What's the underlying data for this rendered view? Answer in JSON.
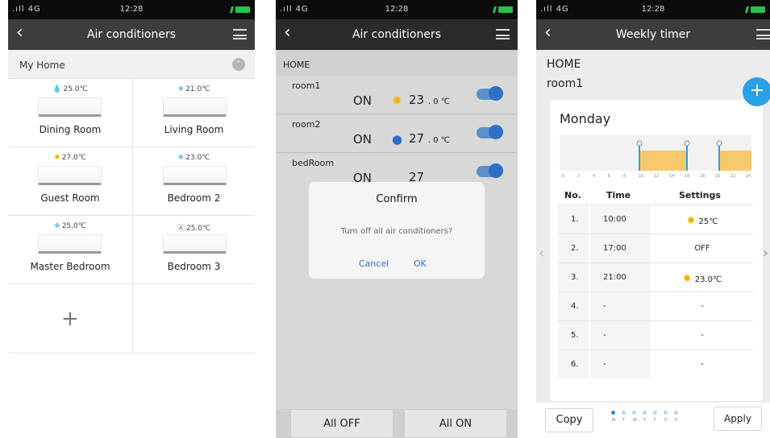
{
  "status": {
    "signal": ".ıll 4G",
    "time": "12:28"
  },
  "screen1": {
    "title": "Air conditioners",
    "group": "My Home",
    "rooms": [
      {
        "name": "Dining Room",
        "temp": "25.0℃",
        "icon": "droplet-icon"
      },
      {
        "name": "Living Room",
        "temp": "21.0℃",
        "icon": "snowflake-icon"
      },
      {
        "name": "Guest Room",
        "temp": "27.0℃",
        "icon": "sun-icon"
      },
      {
        "name": "Bedroom 2",
        "temp": "23.0℃",
        "icon": "snowflake-icon"
      },
      {
        "name": "Master Bedroom",
        "temp": "25.0℃",
        "icon": "snowflake-icon"
      },
      {
        "name": "Bedroom 3",
        "temp": "25.0℃",
        "icon": "auto-icon"
      }
    ],
    "add": "+"
  },
  "screen2": {
    "title": "Air conditioners",
    "home": "HOME",
    "rooms": [
      {
        "name": "room1",
        "state": "ON",
        "temp": "23",
        "unit": ". 0 ℃",
        "icon": "sun-icon"
      },
      {
        "name": "room2",
        "state": "ON",
        "temp": "27",
        "unit": ". 0 ℃",
        "icon": "fan-icon"
      },
      {
        "name": "bedRoom",
        "state": "ON",
        "temp": "27",
        "unit": "",
        "icon": "sun-icon"
      }
    ],
    "dialog": {
      "title": "Confirm",
      "message": "Turn off all air conditioners?",
      "cancel": "Cancel",
      "ok": "OK"
    },
    "all_off": "All OFF",
    "all_on": "All ON"
  },
  "screen3": {
    "title": "Weekly timer",
    "home": "HOME",
    "room": "room1",
    "add": "+",
    "day": "Monday",
    "cols": {
      "no": "No.",
      "time": "Time",
      "settings": "Settings"
    },
    "rows": [
      {
        "no": "1.",
        "time": "10:00",
        "setting": "25℃",
        "icon": "sun-icon"
      },
      {
        "no": "2.",
        "time": "17:00",
        "setting": "OFF",
        "icon": ""
      },
      {
        "no": "3.",
        "time": "21:00",
        "setting": "23.0℃",
        "icon": "sun-icon"
      },
      {
        "no": "4.",
        "time": "-",
        "setting": "-",
        "icon": ""
      },
      {
        "no": "5.",
        "time": "-",
        "setting": "-",
        "icon": ""
      },
      {
        "no": "6.",
        "time": "-",
        "setting": "-",
        "icon": ""
      }
    ],
    "hours": [
      "0",
      "2",
      "4",
      "6",
      "8",
      "10",
      "12",
      "14",
      "16",
      "18",
      "20",
      "22",
      "24"
    ],
    "days": [
      "M",
      "T",
      "W",
      "T",
      "F",
      "S",
      "S"
    ],
    "copy": "Copy",
    "apply": "Apply",
    "accent": "#2aa0e6"
  }
}
